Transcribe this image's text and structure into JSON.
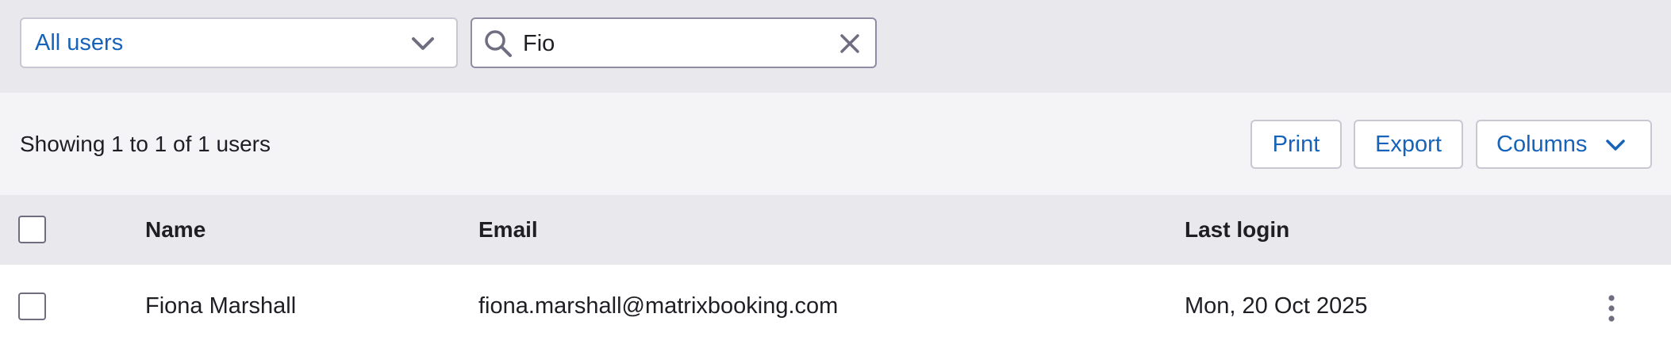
{
  "filter": {
    "user_select_value": "All users",
    "search_value": "Fio"
  },
  "toolbar": {
    "showing_text": "Showing 1 to 1 of 1 users",
    "print_label": "Print",
    "export_label": "Export",
    "columns_label": "Columns"
  },
  "table": {
    "headers": {
      "name": "Name",
      "email": "Email",
      "last_login": "Last login"
    },
    "rows": [
      {
        "name": "Fiona Marshall",
        "email": "fiona.marshall@matrixbooking.com",
        "last_login": "Mon, 20 Oct 2025"
      }
    ]
  },
  "colors": {
    "accent": "#1663b9",
    "header_bg": "#e9e8ed",
    "toolbar_bg": "#f4f4f6"
  },
  "icons": [
    "chevron-down-icon",
    "search-icon",
    "clear-icon",
    "kebab-menu-icon"
  ]
}
